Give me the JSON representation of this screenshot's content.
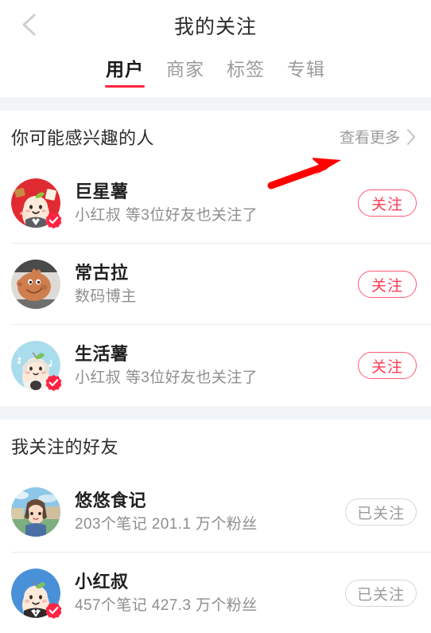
{
  "header": {
    "title": "我的关注",
    "back_icon": "chevron-left-icon"
  },
  "tabs": [
    {
      "label": "用户",
      "active": true
    },
    {
      "label": "商家",
      "active": false
    },
    {
      "label": "标签",
      "active": false
    },
    {
      "label": "专辑",
      "active": false
    }
  ],
  "sections": [
    {
      "title": "你可能感兴趣的人",
      "more_label": "查看更多",
      "more_icon": "chevron-right-icon",
      "users": [
        {
          "name": "巨星薯",
          "subtitle": "小红叔 等3位好友也关注了",
          "button_label": "关注",
          "followed": false,
          "verified": true,
          "avatar": "juxingshu-mascot-avatar"
        },
        {
          "name": "常古拉",
          "subtitle": "数码博主",
          "button_label": "关注",
          "followed": false,
          "verified": false,
          "avatar": "pig-photo-avatar"
        },
        {
          "name": "生活薯",
          "subtitle": "小红叔 等3位好友也关注了",
          "button_label": "关注",
          "followed": false,
          "verified": true,
          "avatar": "shenghuoshu-mascot-avatar"
        }
      ]
    },
    {
      "title": "我关注的好友",
      "more_label": "",
      "users": [
        {
          "name": "悠悠食记",
          "subtitle": "203个笔记   201.1 万个粉丝",
          "button_label": "已关注",
          "followed": true,
          "verified": false,
          "avatar": "girl-photo-avatar"
        },
        {
          "name": "小红叔",
          "subtitle": "457个笔记   427.3 万个粉丝",
          "button_label": "已关注",
          "followed": true,
          "verified": true,
          "avatar": "xiaohongshu-mascot-avatar"
        }
      ]
    }
  ],
  "annotation": {
    "type": "red-arrow",
    "color": "#ff0000",
    "points_to": "查看更多"
  },
  "colors": {
    "accent_red": "#ff2442",
    "follow_border": "#ff5a72",
    "followed_border": "#d6d6d6",
    "band": "#f2f5f8",
    "text_primary": "#1f1f1f",
    "text_secondary": "#8e8e8e"
  }
}
